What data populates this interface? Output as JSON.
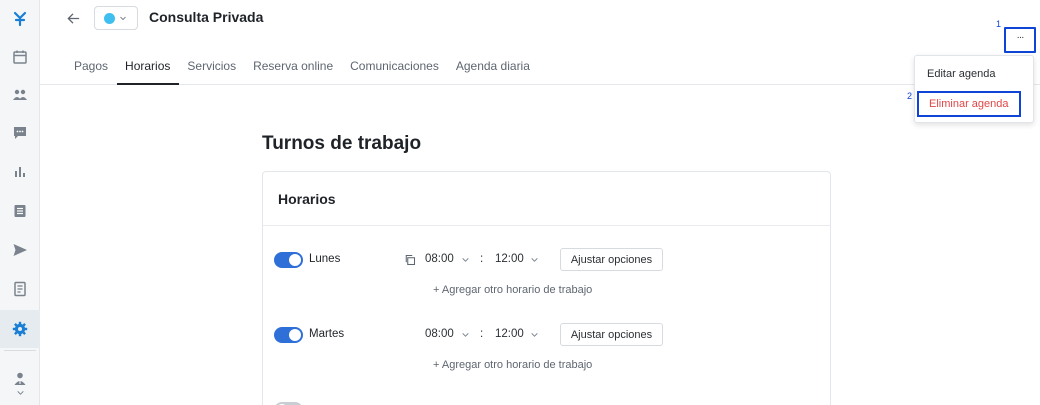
{
  "header": {
    "title": "Consulta Privada",
    "color_dot": "#3fbfef"
  },
  "tabs": [
    {
      "label": "Pagos",
      "active": false
    },
    {
      "label": "Horarios",
      "active": true
    },
    {
      "label": "Servicios",
      "active": false
    },
    {
      "label": "Reserva online",
      "active": false
    },
    {
      "label": "Comunicaciones",
      "active": false
    },
    {
      "label": "Agenda diaria",
      "active": false
    }
  ],
  "more_menu": {
    "label": "···",
    "marker": "1",
    "items": [
      {
        "label": "Editar agenda"
      },
      {
        "label": "Eliminar agenda",
        "marker": "2"
      }
    ]
  },
  "main": {
    "section_title": "Turnos de trabajo",
    "card_title": "Horarios",
    "add_link": "+ Agregar otro horario de trabajo",
    "adjust_label": "Ajustar opciones",
    "rows": [
      {
        "day": "Lunes",
        "enabled": true,
        "start": "08:00",
        "end": "12:00"
      },
      {
        "day": "Martes",
        "enabled": true,
        "start": "08:00",
        "end": "12:00"
      }
    ]
  },
  "colors": {
    "accent": "#2e6fd8",
    "highlight": "#0f45d6",
    "danger": "#e04646",
    "logo": "#1a7fd4"
  }
}
